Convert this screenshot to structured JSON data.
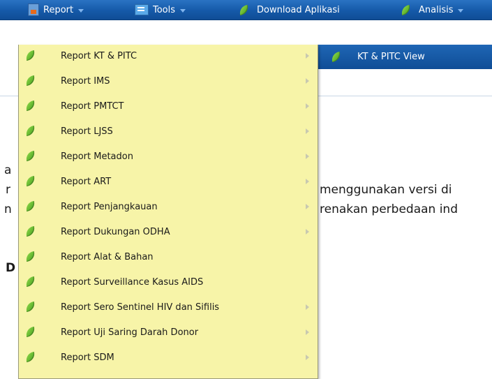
{
  "menubar": {
    "items": [
      {
        "label": "Report",
        "icon": "report-icon",
        "has_caret": true
      },
      {
        "label": "Tools",
        "icon": "tools-icon",
        "has_caret": true
      },
      {
        "label": "Download Aplikasi",
        "icon": "leaf-icon",
        "has_caret": false
      },
      {
        "label": "Analisis",
        "icon": "leaf-icon",
        "has_caret": true
      }
    ]
  },
  "subbar": {
    "label": "KT & PITC View",
    "icon": "leaf-icon"
  },
  "background_text": {
    "line1": "a",
    "line2": "r",
    "line3": "n",
    "line4": "D",
    "line2_right": "menggunakan versi di",
    "line3_right": "renakan perbedaan ind"
  },
  "dropdown": {
    "items": [
      {
        "label": "Report KT & PITC",
        "has_submenu": true
      },
      {
        "label": "Report IMS",
        "has_submenu": true
      },
      {
        "label": "Report PMTCT",
        "has_submenu": true
      },
      {
        "label": "Report LJSS",
        "has_submenu": true
      },
      {
        "label": "Report Metadon",
        "has_submenu": true
      },
      {
        "label": "Report ART",
        "has_submenu": true
      },
      {
        "label": "Report Penjangkauan",
        "has_submenu": true
      },
      {
        "label": "Report Dukungan ODHA",
        "has_submenu": true
      },
      {
        "label": "Report Alat & Bahan",
        "has_submenu": false
      },
      {
        "label": "Report Surveillance Kasus AIDS",
        "has_submenu": false
      },
      {
        "label": "Report Sero Sentinel HIV dan Sifilis",
        "has_submenu": true
      },
      {
        "label": "Report Uji Saring Darah Donor",
        "has_submenu": true
      },
      {
        "label": "Report SDM",
        "has_submenu": true
      }
    ]
  },
  "colors": {
    "menubar": "#1559a8",
    "dropdown_bg": "#f7f4a8",
    "menu_text": "#ffffff"
  }
}
